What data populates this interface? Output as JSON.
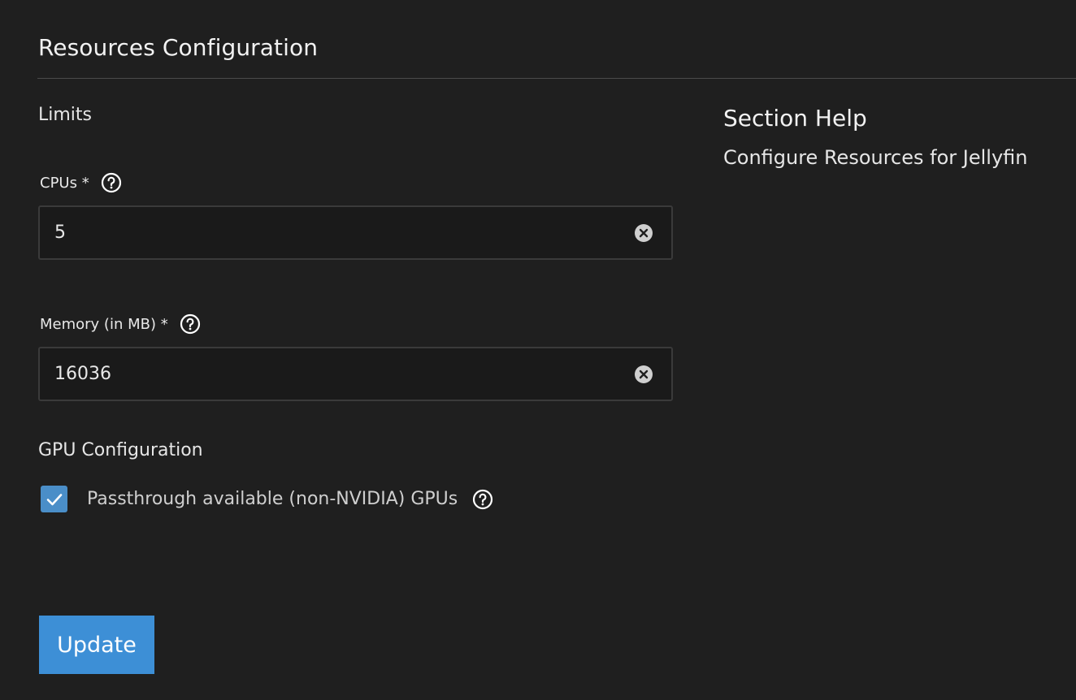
{
  "header": {
    "title": "Resources Configuration"
  },
  "limits": {
    "section_label": "Limits",
    "cpus": {
      "label": "CPUs *",
      "value": "5"
    },
    "memory": {
      "label": "Memory (in MB) *",
      "value": "16036"
    }
  },
  "gpu": {
    "section_label": "GPU Configuration",
    "passthrough": {
      "label": "Passthrough available (non-NVIDIA) GPUs",
      "checked": true
    }
  },
  "actions": {
    "update_label": "Update"
  },
  "help": {
    "title": "Section Help",
    "text": "Configure Resources for Jellyfin"
  },
  "colors": {
    "background": "#1f1f1f",
    "primary_button": "#3d8fd6",
    "checkbox": "#4a8ec8"
  },
  "icons": {
    "help": "help-circle-icon",
    "clear": "clear-circle-icon",
    "check": "checkmark-icon"
  }
}
